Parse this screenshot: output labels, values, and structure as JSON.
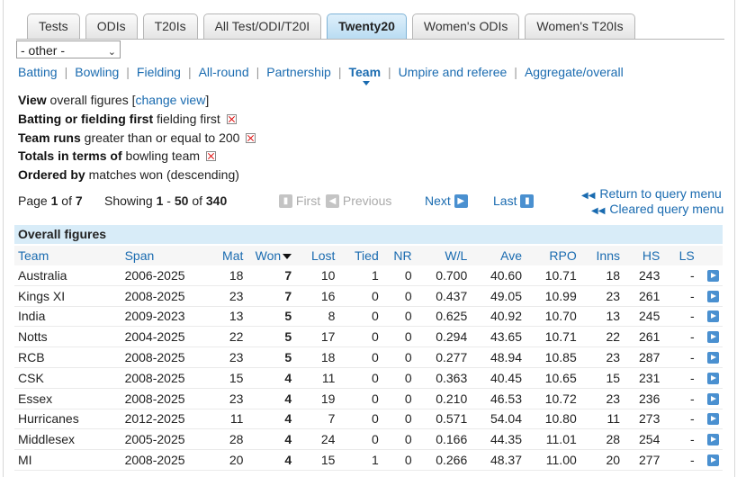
{
  "tabs": [
    {
      "label": "Tests",
      "active": false
    },
    {
      "label": "ODIs",
      "active": false
    },
    {
      "label": "T20Is",
      "active": false
    },
    {
      "label": "All Test/ODI/T20I",
      "active": false
    },
    {
      "label": "Twenty20",
      "active": true
    },
    {
      "label": "Women's ODIs",
      "active": false
    },
    {
      "label": "Women's T20Is",
      "active": false
    }
  ],
  "other_select": {
    "value": "- other -"
  },
  "nav": {
    "items": [
      {
        "label": "Batting"
      },
      {
        "label": "Bowling"
      },
      {
        "label": "Fielding"
      },
      {
        "label": "All-round"
      },
      {
        "label": "Partnership"
      },
      {
        "label": "Team",
        "current": true
      },
      {
        "label": "Umpire and referee"
      },
      {
        "label": "Aggregate/overall"
      }
    ]
  },
  "criteria": {
    "view": {
      "key": "View",
      "text": "overall figures [",
      "link": "change view",
      "end": "]"
    },
    "bat_field": {
      "key": "Batting or fielding first",
      "text": "fielding first"
    },
    "team_runs": {
      "key": "Team runs",
      "text": "greater than or equal to 200"
    },
    "totals": {
      "key": "Totals in terms of",
      "text": "bowling team"
    },
    "ordered": {
      "key": "Ordered by",
      "text": "matches won (descending)"
    }
  },
  "pager": {
    "page_label": "Page",
    "page": "1",
    "of_label": "of",
    "pages": "7",
    "showing_label": "Showing",
    "from": "1",
    "dash": "-",
    "to": "50",
    "of2": "of",
    "total": "340",
    "first": "First",
    "previous": "Previous",
    "next": "Next",
    "last": "Last"
  },
  "return_links": {
    "query": "Return to query menu",
    "cleared": "Cleared query menu"
  },
  "table": {
    "caption": "Overall figures",
    "headers": [
      "Team",
      "Span",
      "Mat",
      "Won",
      "Lost",
      "Tied",
      "NR",
      "W/L",
      "Ave",
      "RPO",
      "Inns",
      "HS",
      "LS"
    ],
    "rows": [
      [
        "Australia",
        "2006-2025",
        "18",
        "7",
        "10",
        "1",
        "0",
        "0.700",
        "40.60",
        "10.71",
        "18",
        "243",
        "-"
      ],
      [
        "Kings XI",
        "2008-2025",
        "23",
        "7",
        "16",
        "0",
        "0",
        "0.437",
        "49.05",
        "10.99",
        "23",
        "261",
        "-"
      ],
      [
        "India",
        "2009-2023",
        "13",
        "5",
        "8",
        "0",
        "0",
        "0.625",
        "40.92",
        "10.70",
        "13",
        "245",
        "-"
      ],
      [
        "Notts",
        "2004-2025",
        "22",
        "5",
        "17",
        "0",
        "0",
        "0.294",
        "43.65",
        "10.71",
        "22",
        "261",
        "-"
      ],
      [
        "RCB",
        "2008-2025",
        "23",
        "5",
        "18",
        "0",
        "0",
        "0.277",
        "48.94",
        "10.85",
        "23",
        "287",
        "-"
      ],
      [
        "CSK",
        "2008-2025",
        "15",
        "4",
        "11",
        "0",
        "0",
        "0.363",
        "40.45",
        "10.65",
        "15",
        "231",
        "-"
      ],
      [
        "Essex",
        "2008-2025",
        "23",
        "4",
        "19",
        "0",
        "0",
        "0.210",
        "46.53",
        "10.72",
        "23",
        "236",
        "-"
      ],
      [
        "Hurricanes",
        "2012-2025",
        "11",
        "4",
        "7",
        "0",
        "0",
        "0.571",
        "54.04",
        "10.80",
        "11",
        "273",
        "-"
      ],
      [
        "Middlesex",
        "2005-2025",
        "28",
        "4",
        "24",
        "0",
        "0",
        "0.166",
        "44.35",
        "11.01",
        "28",
        "254",
        "-"
      ],
      [
        "MI",
        "2008-2025",
        "20",
        "4",
        "15",
        "1",
        "0",
        "0.266",
        "48.37",
        "11.00",
        "20",
        "277",
        "-"
      ]
    ]
  }
}
